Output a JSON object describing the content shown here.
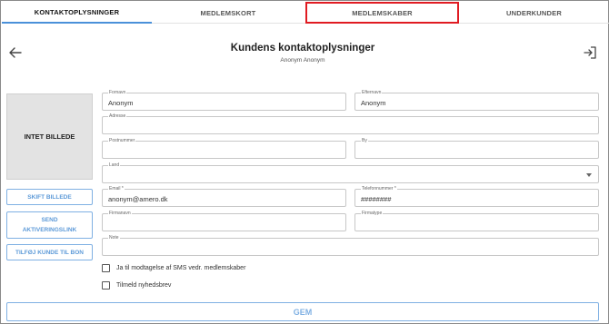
{
  "tabs": [
    {
      "label": "KONTAKTOPLYSNINGER"
    },
    {
      "label": "MEDLEMSKORT"
    },
    {
      "label": "MEDLEMSKABER"
    },
    {
      "label": "UNDERKUNDER"
    }
  ],
  "header": {
    "title": "Kundens kontaktoplysninger",
    "subtitle": "Anonym Anonym",
    "back_icon": "arrow-left-icon",
    "exit_icon": "exit-icon"
  },
  "photo": {
    "label": "INTET BILLEDE"
  },
  "side_buttons": {
    "change_photo": "SKIFT BILLEDE",
    "send_activation": "SEND AKTIVERINGSLINK",
    "add_to_receipt": "TILFØJ KUNDE TIL BON"
  },
  "form": {
    "fornavn": {
      "label": "Fornavn",
      "value": "Anonym"
    },
    "efternavn": {
      "label": "Efternavn",
      "value": "Anonym"
    },
    "adresse": {
      "label": "Adresse",
      "value": ""
    },
    "postnummer": {
      "label": "Postnummer",
      "value": ""
    },
    "by": {
      "label": "By",
      "value": ""
    },
    "land": {
      "label": "Land",
      "value": ""
    },
    "email": {
      "label": "Email *",
      "value": "anonym@amero.dk"
    },
    "telefon": {
      "label": "Telefonnummer *",
      "value": "########"
    },
    "firmanavn": {
      "label": "Firmanavn",
      "value": ""
    },
    "firmatype": {
      "label": "Firmatype",
      "value": ""
    },
    "note": {
      "label": "Note",
      "value": ""
    }
  },
  "checkboxes": {
    "sms": {
      "label": "Ja til modtagelse af SMS vedr. medlemskaber",
      "checked": false
    },
    "newsletter": {
      "label": "Tilmeld nyhedsbrev",
      "checked": false
    }
  },
  "save_button": {
    "label": "GEM"
  },
  "colors": {
    "accent": "#4a90d9",
    "button_border": "#7fb0e3",
    "highlight": "#e01b22",
    "photo_bg": "#e3e3e3"
  }
}
